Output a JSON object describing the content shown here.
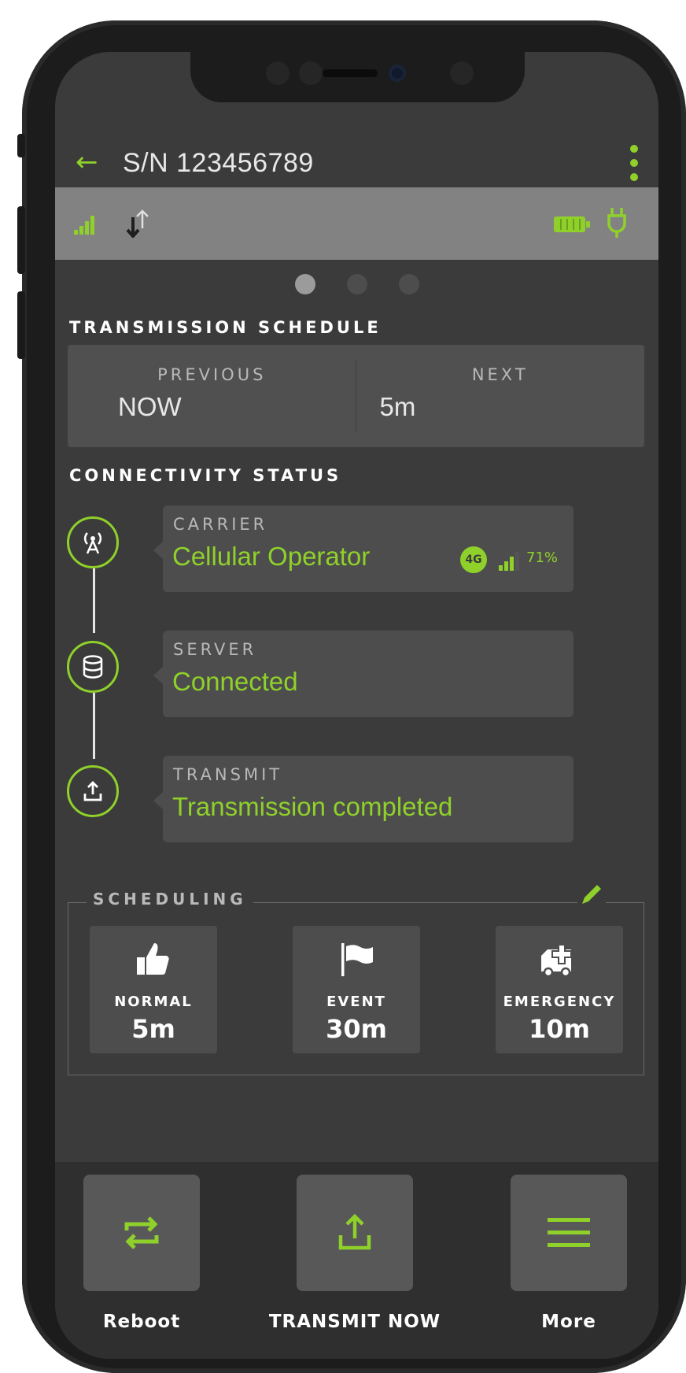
{
  "header": {
    "back_icon": "arrow-left-icon",
    "title": "S/N 123456789",
    "menu_icon": "kebab-menu-icon"
  },
  "status_bar": {
    "icons": [
      "signal-icon",
      "data-transfer-icon",
      "battery-icon",
      "plug-icon"
    ]
  },
  "pager": {
    "count": 3,
    "active": 0
  },
  "transmission_schedule": {
    "heading": "TRANSMISSION SCHEDULE",
    "previous_label": "PREVIOUS",
    "previous_value": "NOW",
    "next_label": "NEXT",
    "next_value": "5m"
  },
  "connectivity": {
    "heading": "CONNECTIVITY STATUS",
    "carrier": {
      "label": "CARRIER",
      "value": "Cellular Operator",
      "network": "4G",
      "signal_percent": "71%"
    },
    "server": {
      "label": "SERVER",
      "value": "Connected"
    },
    "transmit": {
      "label": "TRANSMIT",
      "value": "Transmission completed"
    }
  },
  "scheduling": {
    "legend": "SCHEDULING",
    "modes": [
      {
        "label": "NORMAL",
        "value": "5m",
        "icon": "thumbs-up-icon"
      },
      {
        "label": "EVENT",
        "value": "30m",
        "icon": "flag-icon"
      },
      {
        "label": "EMERGENCY",
        "value": "10m",
        "icon": "ambulance-icon"
      }
    ]
  },
  "actions": [
    {
      "label": "Reboot",
      "icon": "reboot-icon"
    },
    {
      "label": "TRANSMIT NOW",
      "icon": "upload-icon"
    },
    {
      "label": "More",
      "icon": "hamburger-icon"
    }
  ],
  "colors": {
    "accent": "#8fd12a",
    "background": "#3b3b3b",
    "card": "#4d4d4d",
    "statusbar": "#828282"
  }
}
